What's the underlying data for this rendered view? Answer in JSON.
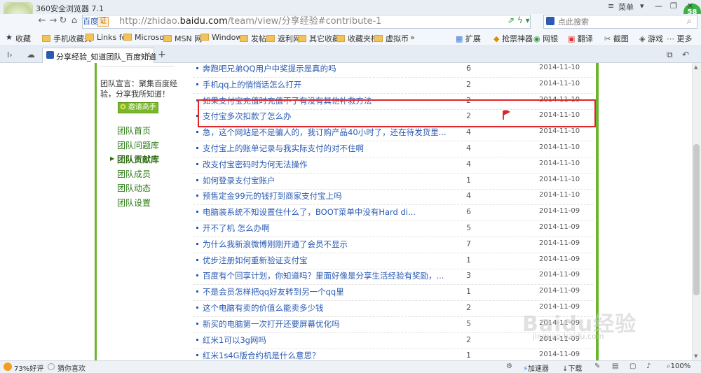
{
  "browser": {
    "title": "360安全浏览器 7.1",
    "window": {
      "menu_label": "菜单",
      "minimize": "—",
      "restore": "❐",
      "close": "✕"
    },
    "badge": "58",
    "address": {
      "engine": "百度",
      "cert": "证",
      "url_prefix": "http://zhidao.",
      "url_domain": "baidu.com",
      "url_rest": "/team/view/分享经验#contribute-1"
    },
    "search": {
      "placeholder": "点此搜索"
    },
    "bookmarks": [
      "收藏",
      "手机收藏夹",
      "Links fo",
      "Microso",
      "MSN 网",
      "Window",
      "发帖",
      "返利网",
      "其它收藏",
      "收藏夹栏",
      "虚拟币",
      "扩展",
      "抢票神器",
      "网银",
      "翻译",
      "截图",
      "游戏",
      "更多"
    ],
    "bookmarks_more": "»",
    "tab": {
      "title": "分享经验_知道团队_百度知道",
      "close": "×",
      "new": "+"
    }
  },
  "sidebar": {
    "slogan": "团队宣言：聚集百度经验，分享我所知道！",
    "invite_button": "邀请高手",
    "nav": [
      {
        "label": "团队首页",
        "active": false
      },
      {
        "label": "团队问题库",
        "active": false
      },
      {
        "label": "团队贡献库",
        "active": true
      },
      {
        "label": "团队成员",
        "active": false
      },
      {
        "label": "团队动态",
        "active": false
      },
      {
        "label": "团队设置",
        "active": false
      }
    ]
  },
  "questions": [
    {
      "title": "奔跑吧兄弟QQ用户中奖提示是真的吗",
      "count": "6",
      "date": "2014-11-10"
    },
    {
      "title": "手机qq上的悄悄话怎么打开",
      "count": "2",
      "date": "2014-11-10"
    },
    {
      "title": "如果支付宝充值时充值不了有没有其他补救方法",
      "count": "2",
      "date": "2014-11-10"
    },
    {
      "title": "支付宝多次扣款了怎么办",
      "count": "2",
      "date": "2014-11-10"
    },
    {
      "title": "急，这个网站是不是骗人的，我订购产品40小时了，还在待发货里...",
      "count": "4",
      "date": "2014-11-10"
    },
    {
      "title": "支付宝上的账单记录与我实际支付的对不住啊",
      "count": "4",
      "date": "2014-11-10"
    },
    {
      "title": "改支付宝密码时为何无法操作",
      "count": "4",
      "date": "2014-11-10"
    },
    {
      "title": "如何登录支付宝账户",
      "count": "1",
      "date": "2014-11-10"
    },
    {
      "title": "预售定金99元的钱打到商家支付宝上吗",
      "count": "4",
      "date": "2014-11-10"
    },
    {
      "title": "电脑装系统不知设置住什么了，BOOT菜单中没有Hard di...",
      "count": "6",
      "date": "2014-11-09"
    },
    {
      "title": "开不了机 怎么办啊",
      "count": "5",
      "date": "2014-11-09"
    },
    {
      "title": "为什么我新浪微博刚刚开通了会员不显示",
      "count": "7",
      "date": "2014-11-09"
    },
    {
      "title": "优步注册如何重新验证支付宝",
      "count": "1",
      "date": "2014-11-09"
    },
    {
      "title": "百度有个回享计划，你知道吗？里面好像是分享生活经验有奖励，...",
      "count": "3",
      "date": "2014-11-09"
    },
    {
      "title": "不是会员怎样把qq好友转到另一个qq里",
      "count": "1",
      "date": "2014-11-09"
    },
    {
      "title": "这个电脑有卖的价值么能卖多少钱",
      "count": "2",
      "date": "2014-11-09"
    },
    {
      "title": "新买的电脑第一次打开还要屏幕优化吗",
      "count": "5",
      "date": "2014-11-09"
    },
    {
      "title": "红米1可以3g网吗",
      "count": "2",
      "date": "2014-11-09"
    },
    {
      "title": "红米1s4G版合约机是什么意思？",
      "count": "1",
      "date": "2014-11-09"
    }
  ],
  "watermark": {
    "text": "Baidu经验",
    "url": "jingyan.baidu.com"
  },
  "status": {
    "rating": "73%好评",
    "guess": "猜你喜欢",
    "accelerator": "加速器",
    "download": "下载",
    "zoom": "100%"
  },
  "colors": {
    "accent_green": "#6bb52d",
    "link_blue": "#2a5ab3",
    "highlight_red": "#e0242a"
  }
}
